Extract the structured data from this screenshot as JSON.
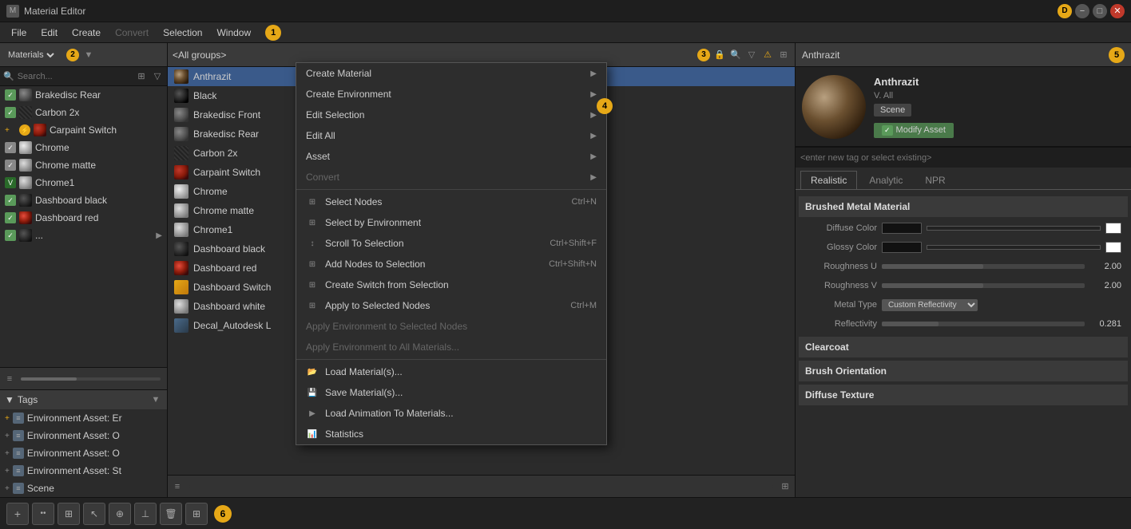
{
  "titleBar": {
    "title": "Material Editor",
    "btn_d": "D",
    "btn_min": "−",
    "btn_max": "□",
    "btn_close": "✕"
  },
  "menuBar": {
    "items": [
      "File",
      "Edit",
      "Create",
      "Convert",
      "Selection",
      "Window"
    ],
    "badge": "1",
    "disabled": [
      "Convert"
    ]
  },
  "leftPanel": {
    "dropdown": "Materials",
    "badge": "2",
    "searchPlaceholder": "Search...",
    "items": [
      {
        "id": "brakedisc-rear",
        "text": "Brakedisc Rear",
        "type": "check"
      },
      {
        "id": "carbon-2x",
        "text": "Carbon 2x",
        "type": "check"
      },
      {
        "id": "carpaint-switch",
        "text": "Carpaint Switch",
        "type": "switch"
      },
      {
        "id": "chrome",
        "text": "Chrome",
        "type": "chrome"
      },
      {
        "id": "chrome-matte",
        "text": "Chrome matte",
        "type": "chrome"
      },
      {
        "id": "chrome1",
        "text": "Chrome1",
        "type": "chrome2"
      },
      {
        "id": "dashboard-black",
        "text": "Dashboard black",
        "type": "check"
      },
      {
        "id": "dashboard-red",
        "text": "Dashboard red",
        "type": "red"
      },
      {
        "id": "more",
        "text": "...",
        "type": "check"
      }
    ]
  },
  "tagsPanel": {
    "label": "Tags",
    "items": [
      "Environment Asset: Er",
      "Environment Asset: O",
      "Environment Asset: O",
      "Environment Asset: St",
      "Scene"
    ]
  },
  "middlePanel": {
    "groupLabel": "<All groups>",
    "badge": "3",
    "items": [
      {
        "id": "anthrazit",
        "text": "Anthrazit",
        "type": "anthrazit",
        "selected": true
      },
      {
        "id": "black",
        "text": "Black",
        "type": "black"
      },
      {
        "id": "brakedisc-front",
        "text": "Brakedisc Front",
        "type": "brakedisc"
      },
      {
        "id": "brakedisc-rear",
        "text": "Brakedisc Rear",
        "type": "brakedisc"
      },
      {
        "id": "carbon-2x",
        "text": "Carbon 2x",
        "type": "carbon"
      },
      {
        "id": "carpaint-switch",
        "text": "Carpaint Switch",
        "type": "carpaint"
      },
      {
        "id": "chrome",
        "text": "Chrome",
        "type": "chrome"
      },
      {
        "id": "chrome-matte",
        "text": "Chrome matte",
        "type": "chrome-matte"
      },
      {
        "id": "chrome1",
        "text": "Chrome1",
        "type": "chrome-matte"
      },
      {
        "id": "dashboard-black",
        "text": "Dashboard black",
        "type": "dashboard-black"
      },
      {
        "id": "dashboard-red",
        "text": "Dashboard red",
        "type": "dashboard-red"
      },
      {
        "id": "dashboard-switch",
        "text": "Dashboard Switch",
        "type": "switch"
      },
      {
        "id": "dashboard-white",
        "text": "Dashboard white",
        "type": "chrome-matte"
      },
      {
        "id": "decal-autodesk",
        "text": "Decal_Autodesk L",
        "type": "decal"
      }
    ]
  },
  "contextMenu": {
    "items": [
      {
        "id": "create-material",
        "label": "Create Material",
        "hasArrow": true
      },
      {
        "id": "create-environment",
        "label": "Create Environment",
        "hasArrow": true
      },
      {
        "id": "edit-selection",
        "label": "Edit Selection",
        "hasArrow": true,
        "badge": "4"
      },
      {
        "id": "edit-all",
        "label": "Edit All",
        "hasArrow": true
      },
      {
        "id": "asset",
        "label": "Asset",
        "hasArrow": true
      },
      {
        "id": "convert",
        "label": "Convert",
        "disabled": true,
        "hasArrow": true
      },
      {
        "id": "sep1",
        "type": "separator"
      },
      {
        "id": "select-nodes",
        "label": "Select Nodes",
        "shortcut": "Ctrl+N",
        "hasIcon": true
      },
      {
        "id": "select-by-env",
        "label": "Select by Environment",
        "hasIcon": true
      },
      {
        "id": "scroll-to-selection",
        "label": "Scroll To Selection",
        "shortcut": "Ctrl+Shift+F",
        "hasIcon": true
      },
      {
        "id": "add-nodes",
        "label": "Add Nodes to Selection",
        "shortcut": "Ctrl+Shift+N",
        "hasIcon": true
      },
      {
        "id": "create-switch",
        "label": "Create Switch from Selection",
        "hasIcon": true
      },
      {
        "id": "apply-selected",
        "label": "Apply to Selected Nodes",
        "shortcut": "Ctrl+M",
        "hasIcon": true
      },
      {
        "id": "apply-env-selected",
        "label": "Apply Environment to Selected Nodes",
        "disabled": true
      },
      {
        "id": "apply-env-all",
        "label": "Apply Environment to All Materials...",
        "disabled": true
      },
      {
        "id": "sep2",
        "type": "separator"
      },
      {
        "id": "load-materials",
        "label": "Load Material(s)...",
        "hasIcon": true
      },
      {
        "id": "save-materials",
        "label": "Save Material(s)...",
        "hasIcon": true
      },
      {
        "id": "load-animation",
        "label": "Load Animation To Materials...",
        "hasIcon": true
      },
      {
        "id": "statistics",
        "label": "Statistics",
        "hasIcon": true
      }
    ]
  },
  "rightPanel": {
    "title": "Anthrazit",
    "badge": "5",
    "previewName": "Anthrazit",
    "previewSub": "V. All",
    "sceneLabel": "Scene",
    "modifyBtn": "Modify Asset",
    "tagPlaceholder": "<enter new tag or select existing>",
    "tabs": [
      "Realistic",
      "Analytic",
      "NPR"
    ],
    "activeTab": "Realistic",
    "sectionTitle": "Brushed Metal Material",
    "properties": [
      {
        "label": "Diffuse Color",
        "type": "color",
        "value": ""
      },
      {
        "label": "Glossy Color",
        "type": "color",
        "value": ""
      },
      {
        "label": "Roughness U",
        "type": "slider",
        "value": "2.00",
        "fill": 50
      },
      {
        "label": "Roughness V",
        "type": "slider",
        "value": "2.00",
        "fill": 50
      },
      {
        "label": "Metal Type",
        "type": "select",
        "value": "Custom Reflectivity"
      },
      {
        "label": "Reflectivity",
        "type": "slider",
        "value": "0.281",
        "fill": 28
      }
    ],
    "sections": [
      "Clearcoat",
      "Brush Orientation",
      "Diffuse Texture"
    ]
  },
  "bottomToolbar": {
    "badge": "6",
    "buttons": [
      "+",
      "••",
      "⊞",
      "↖",
      "⊕",
      "⊥",
      "🗑",
      "⊞"
    ]
  }
}
